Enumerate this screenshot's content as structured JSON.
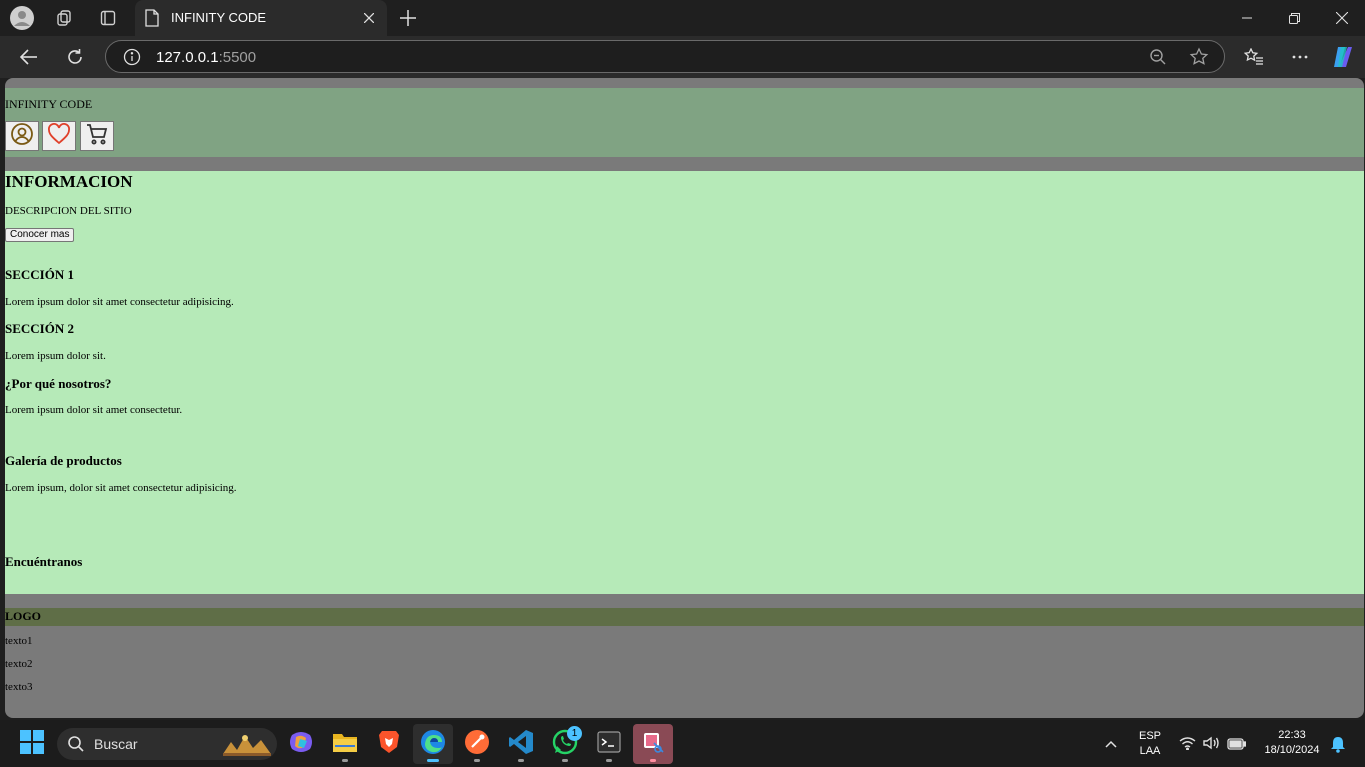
{
  "browser": {
    "tab_title": "INFINITY CODE",
    "url_host": "127.0.0.1",
    "url_port": ":5500"
  },
  "site": {
    "brand": "INFINITY CODE",
    "header_icons": [
      "user-icon",
      "heart-icon",
      "cart-icon"
    ],
    "info_title": "INFORMACION",
    "info_desc": "DESCRIPCION DEL SITIO",
    "info_button": "Conocer mas",
    "sec1_title": "SECCIÓN 1",
    "sec1_text": "Lorem ipsum dolor sit amet consectetur adipisicing.",
    "sec2_title": "SECCIÓN 2",
    "sec2_text": "Lorem ipsum dolor sit.",
    "why_title": "¿Por qué nosotros?",
    "why_text": "Lorem ipsum dolor sit amet consectetur.",
    "gallery_title": "Galería de productos",
    "gallery_text": "Lorem ipsum, dolor sit amet consectetur adipisicing.",
    "find_title": "Encuéntranos",
    "footer_logo": "LOGO",
    "footer_texts": [
      "texto1",
      "texto2",
      "texto3"
    ]
  },
  "colors": {
    "header_bg": "#80a383",
    "main_bg": "#b6eab8",
    "page_bg": "#7a7a7a",
    "footer_bar_bg": "#5f6e47"
  },
  "taskbar": {
    "search_label": "Buscar",
    "lang_top": "ESP",
    "lang_bottom": "LAA",
    "time": "22:33",
    "date": "18/10/2024",
    "whatsapp_badge": "1"
  }
}
